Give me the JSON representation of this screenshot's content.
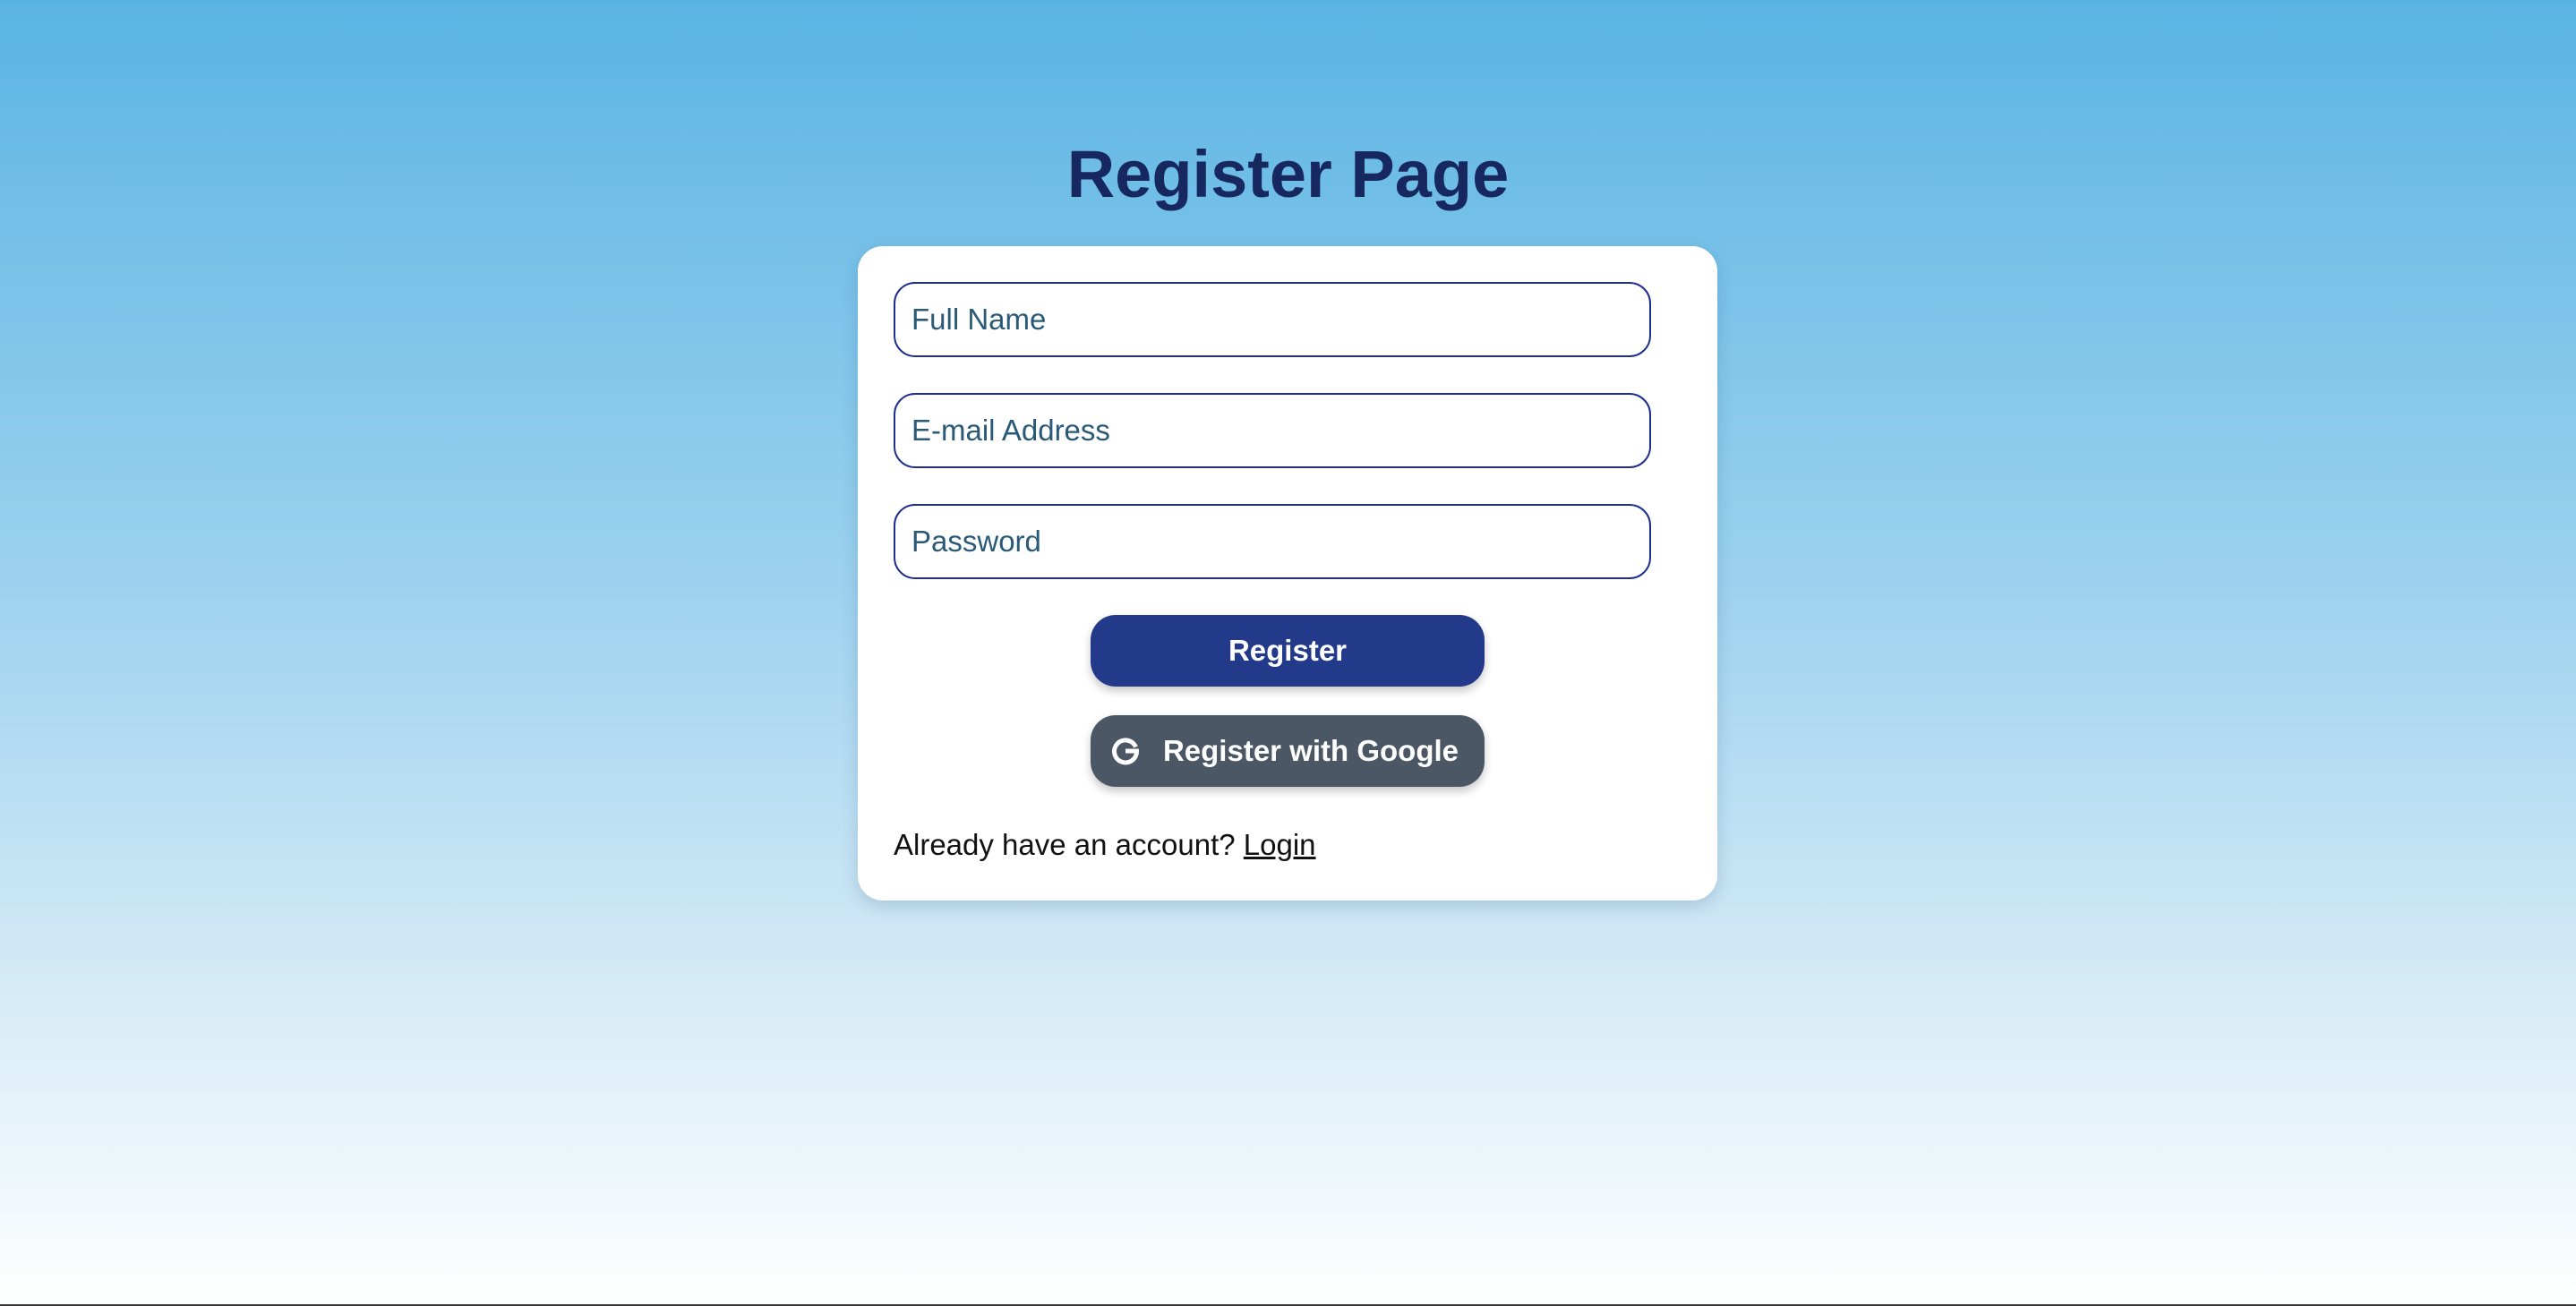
{
  "page": {
    "title": "Register Page"
  },
  "form": {
    "full_name": {
      "placeholder": "Full Name",
      "value": ""
    },
    "email": {
      "placeholder": "E-mail Address",
      "value": ""
    },
    "password": {
      "placeholder": "Password",
      "value": ""
    },
    "register_label": "Register",
    "google_label": "Register with Google",
    "google_icon": "google-g-icon"
  },
  "footer": {
    "prompt": "Already have an account?",
    "login_label": "Login"
  },
  "colors": {
    "title": "#16285f",
    "primary_button": "#233a8a",
    "google_button": "#4c5766",
    "field_border": "#1f2f8f",
    "placeholder": "#2a5a78",
    "background_top": "#5ab4e3",
    "background_bottom": "#ffffff"
  }
}
